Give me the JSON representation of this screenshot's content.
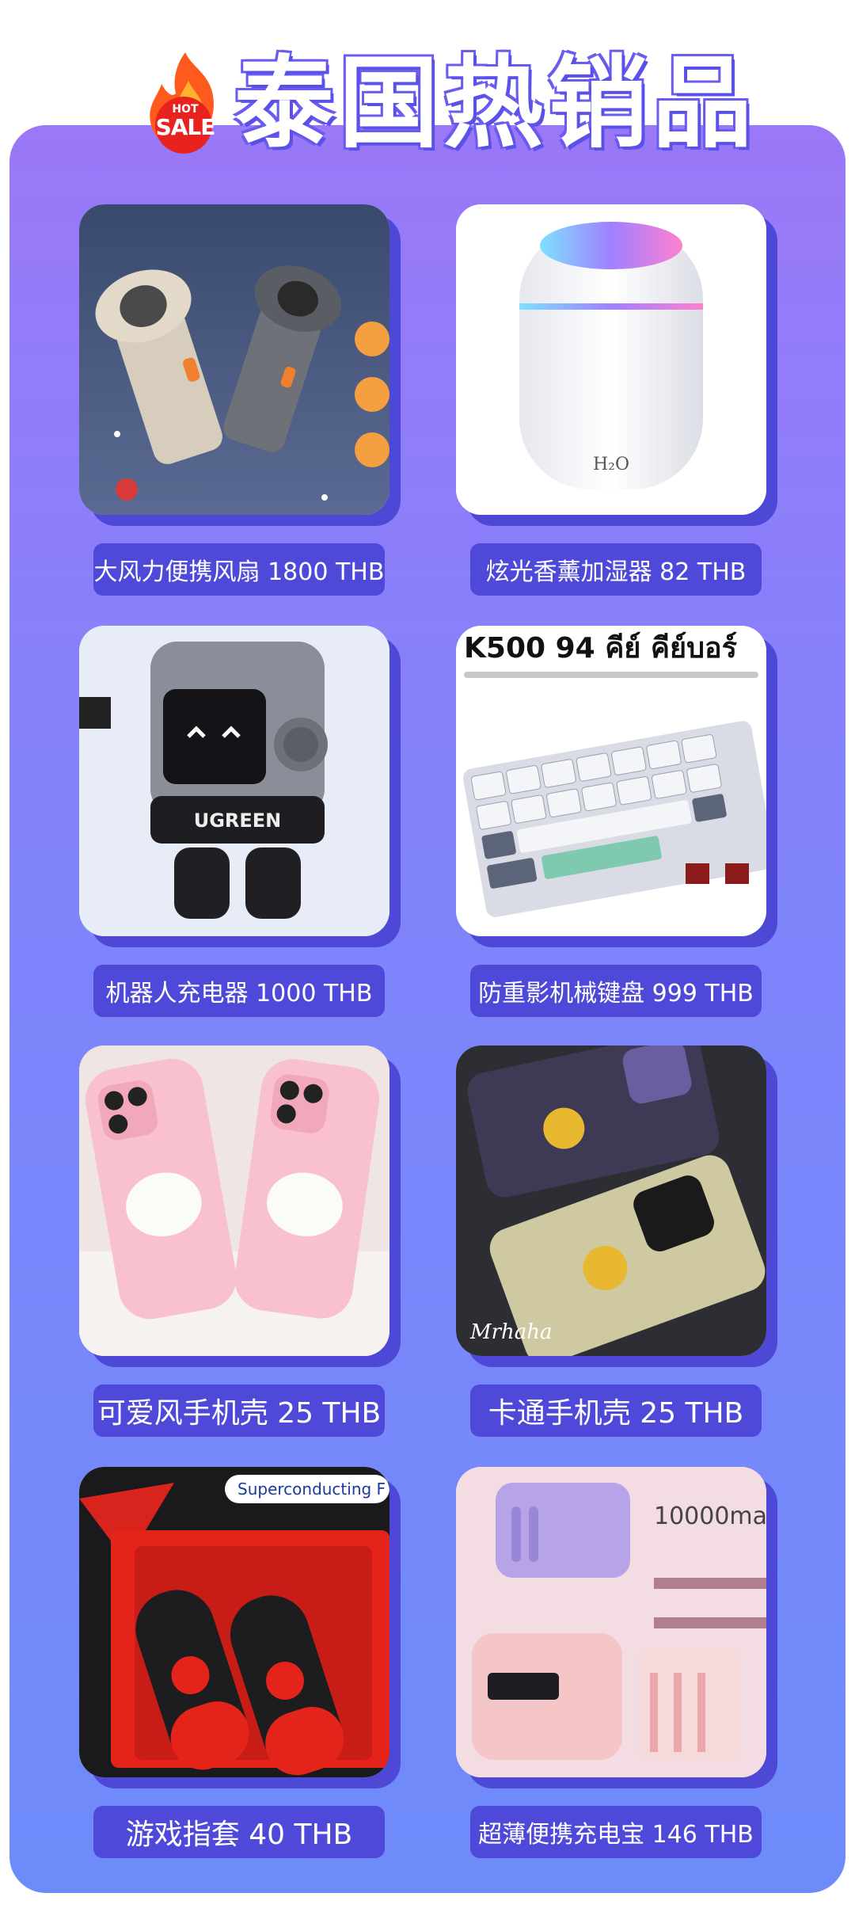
{
  "header": {
    "title": "泰国热销品",
    "badge_top": "HOT",
    "badge_bottom": "SALE"
  },
  "products": [
    {
      "label": "大风力便携风扇 1800 THB",
      "icon": "handheld-fan-image"
    },
    {
      "label": "炫光香薰加湿器 82 THB",
      "icon": "humidifier-image",
      "image_text": "H₂O"
    },
    {
      "label": "机器人充电器 1000 THB",
      "icon": "robot-charger-image",
      "image_text": "UGREEN"
    },
    {
      "label": "防重影机械键盘 999 THB",
      "icon": "keyboard-image",
      "image_text": "K500 94 คีย์ คีย์บอร์"
    },
    {
      "label": "可爱风手机壳 25 THB",
      "icon": "cute-phone-case-image"
    },
    {
      "label": "卡通手机壳 25 THB",
      "icon": "cartoon-phone-case-image",
      "image_text": "Mrhaha"
    },
    {
      "label": "游戏指套    40 THB",
      "icon": "finger-sleeve-image",
      "image_text": "Superconducting F"
    },
    {
      "label": "超薄便携充电宝 146 THB",
      "icon": "power-bank-image",
      "image_text": "10000ma"
    }
  ],
  "colors": {
    "panel_top": "#9a78f8",
    "panel_bottom": "#6e8bfa",
    "label_bg": "#4f49d9",
    "shadow": "#4e48d6"
  }
}
